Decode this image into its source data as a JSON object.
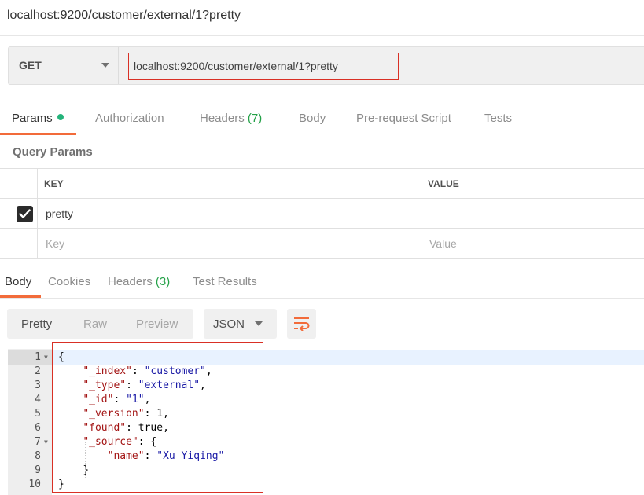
{
  "window": {
    "title": "localhost:9200/customer/external/1?pretty"
  },
  "request": {
    "method": "GET",
    "url": "localhost:9200/customer/external/1?pretty"
  },
  "request_tabs": {
    "params": "Params",
    "authorization": "Authorization",
    "headers": "Headers",
    "headers_count": "(7)",
    "body": "Body",
    "prerequest": "Pre-request Script",
    "tests": "Tests"
  },
  "query_params": {
    "title": "Query Params",
    "key_header": "KEY",
    "value_header": "VALUE",
    "rows": [
      {
        "key": "pretty",
        "value": "",
        "checked": true
      }
    ],
    "key_placeholder": "Key",
    "value_placeholder": "Value"
  },
  "response_tabs": {
    "body": "Body",
    "cookies": "Cookies",
    "headers": "Headers",
    "headers_count": "(3)",
    "test_results": "Test Results"
  },
  "view_modes": {
    "pretty": "Pretty",
    "raw": "Raw",
    "preview": "Preview",
    "format": "JSON"
  },
  "icons": {
    "dropdown": "chevron-down-icon",
    "check": "check-icon",
    "wrap": "wrap-lines-icon"
  },
  "colors": {
    "accent": "#f26b3a",
    "success": "#24b37a",
    "highlight": "#d93025"
  },
  "response": {
    "line_numbers": [
      "1",
      "2",
      "3",
      "4",
      "5",
      "6",
      "7",
      "8",
      "9",
      "10"
    ],
    "code": {
      "l1": "{",
      "l2_key": "\"_index\"",
      "l2_val": "\"customer\"",
      "l3_key": "\"_type\"",
      "l3_val": "\"external\"",
      "l4_key": "\"_id\"",
      "l4_val": "\"1\"",
      "l5_key": "\"_version\"",
      "l5_val": "1",
      "l6_key": "\"found\"",
      "l6_val": "true",
      "l7_key": "\"_source\"",
      "l8_key": "\"name\"",
      "l8_val": "\"Xu Yiqing\"",
      "l9": "}",
      "l10": "}"
    }
  }
}
